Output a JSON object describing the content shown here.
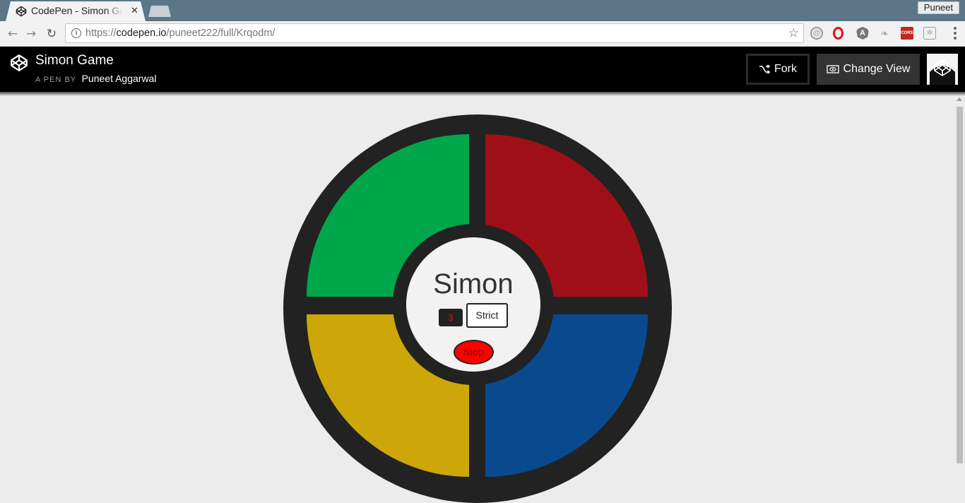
{
  "browser": {
    "tab_title": "CodePen - Simon Game",
    "profile_name": "Puneet",
    "url_scheme": "https://",
    "url_host": "codepen.io",
    "url_path": "/puneet222/full/Krqodm/",
    "extensions": [
      "eye-ext-icon",
      "opera-icon",
      "angular-icon",
      "feather-icon",
      "cors-icon",
      "react-icon"
    ]
  },
  "codepen": {
    "pen_title": "Simon Game",
    "byline_prefix": "A PEN BY",
    "author": "Puneet Aggarwal",
    "fork_label": "Fork",
    "change_view_label": "Change View"
  },
  "game": {
    "title": "Simon",
    "count": "3",
    "strict_label": "Strict",
    "stop_label": "Stop",
    "colors": {
      "green": "#00a74a",
      "red": "#9f0f17",
      "yellow": "#cca707",
      "blue": "#094a8f",
      "count_text": "#e21010",
      "stop_button": "#ff0000"
    }
  }
}
